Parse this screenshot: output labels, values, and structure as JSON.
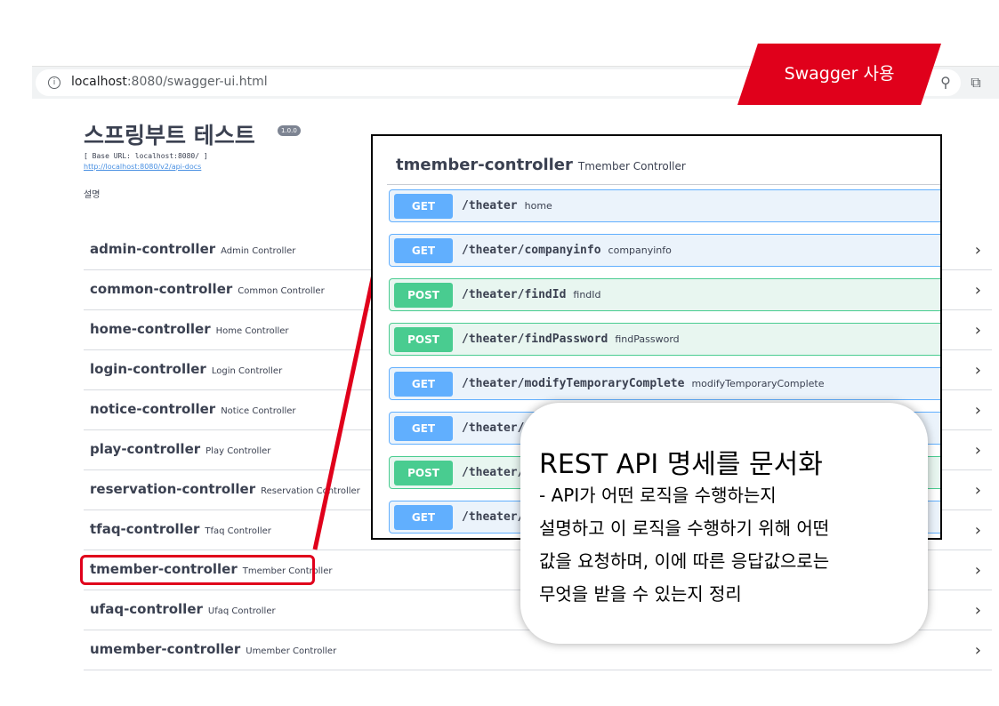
{
  "browser": {
    "url_host": "localhost",
    "url_rest": ":8080/swagger-ui.html"
  },
  "banner": {
    "label": "Swagger 사용",
    "color": "#e0001b"
  },
  "swagger": {
    "title": "스프링부트 테스트",
    "version": "1.0.0",
    "base_url": "[ Base URL: localhost:8080/ ]",
    "api_docs": "http://localhost:8080/v2/api-docs",
    "description": "설명"
  },
  "controllers": [
    {
      "name": "admin-controller",
      "desc": "Admin Controller"
    },
    {
      "name": "common-controller",
      "desc": "Common Controller"
    },
    {
      "name": "home-controller",
      "desc": "Home Controller"
    },
    {
      "name": "login-controller",
      "desc": "Login Controller"
    },
    {
      "name": "notice-controller",
      "desc": "Notice Controller"
    },
    {
      "name": "play-controller",
      "desc": "Play Controller"
    },
    {
      "name": "reservation-controller",
      "desc": "Reservation Controller"
    },
    {
      "name": "tfaq-controller",
      "desc": "Tfaq Controller"
    },
    {
      "name": "tmember-controller",
      "desc": "Tmember Controller"
    },
    {
      "name": "ufaq-controller",
      "desc": "Ufaq Controller"
    },
    {
      "name": "umember-controller",
      "desc": "Umember Controller"
    }
  ],
  "panel": {
    "name": "tmember-controller",
    "desc": "Tmember Controller",
    "operations": [
      {
        "method": "GET",
        "path": "/theater",
        "summary": "home"
      },
      {
        "method": "GET",
        "path": "/theater/companyinfo",
        "summary": "companyinfo"
      },
      {
        "method": "POST",
        "path": "/theater/findId",
        "summary": "findId"
      },
      {
        "method": "POST",
        "path": "/theater/findPassword",
        "summary": "findPassword"
      },
      {
        "method": "GET",
        "path": "/theater/modifyTemporaryComplete",
        "summary": "modifyTemporaryComplete"
      },
      {
        "method": "GET",
        "path": "/theater/",
        "summary": ""
      },
      {
        "method": "POST",
        "path": "/theater/",
        "summary": ""
      },
      {
        "method": "GET",
        "path": "/theater/",
        "summary": ""
      }
    ]
  },
  "callout": {
    "title": "REST API 명세를 문서화",
    "lines": [
      "- API가 어떤 로직을 수행하는지",
      "설명하고 이 로직을 수행하기 위해 어떤",
      "값을 요청하며, 이에 따른 응답값으로는",
      "무엇을 받을 수 있는지 정리"
    ]
  },
  "colors": {
    "get": "#61affe",
    "post": "#49cc90",
    "highlight": "#e0001b"
  }
}
